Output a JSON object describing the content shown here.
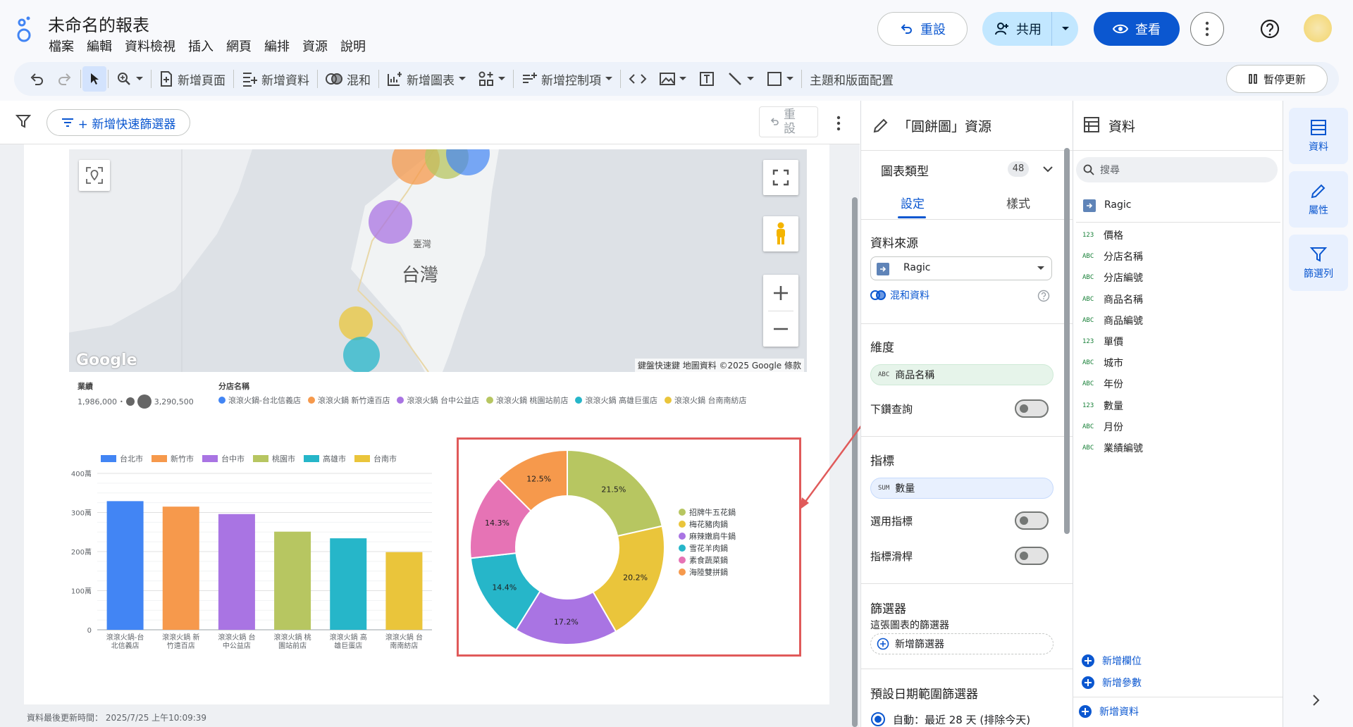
{
  "app": {
    "doc_title": "未命名的報表",
    "menu": [
      "檔案",
      "編輯",
      "資料檢視",
      "插入",
      "網頁",
      "編排",
      "資源",
      "說明"
    ],
    "reset_label": "重設",
    "share_label": "共用",
    "view_label": "查看"
  },
  "toolbar": {
    "add_page": "新增頁面",
    "add_data": "新增資料",
    "blend": "混和",
    "add_chart": "新增圖表",
    "add_control": "新增控制項",
    "theme": "主題和版面配置",
    "pause": "暫停更新"
  },
  "canvas": {
    "quick_filter": "+ 新增快速篩選器",
    "reset_label": "重設",
    "last_update": "資料最後更新時間：  2025/7/25 上午10:09:39"
  },
  "map": {
    "label_taiwan": "台灣",
    "label_taiwan_small": "臺灣",
    "google": "Google",
    "attribution": "鍵盤快速鍵    地圖資料 ©2025 Google    條款",
    "legend_metric_title": "業績",
    "legend_min": "1,986,000",
    "legend_max": "3,290,500",
    "legend_dim_title": "分店名稱",
    "stores": [
      {
        "name": "滾滾火鍋-台北信義店",
        "color": "#4285f4"
      },
      {
        "name": "滾滾火鍋 新竹遠百店",
        "color": "#f6994c"
      },
      {
        "name": "滾滾火鍋 台中公益店",
        "color": "#a974e3"
      },
      {
        "name": "滾滾火鍋 桃園站前店",
        "color": "#b7c661"
      },
      {
        "name": "滾滾火鍋 高雄巨蛋店",
        "color": "#26b6c9"
      },
      {
        "name": "滾滾火鍋 台南南紡店",
        "color": "#eac53b"
      }
    ]
  },
  "chart_data": [
    {
      "type": "bar",
      "title": "",
      "legend": [
        "台北市",
        "新竹市",
        "台中市",
        "桃園市",
        "高雄市",
        "台南市"
      ],
      "legend_position": "top",
      "categories": [
        "滾滾火鍋-台北信義店",
        "滾滾火鍋 新竹遠百店",
        "滾滾火鍋 台中公益店",
        "滾滾火鍋 桃園站前店",
        "滾滾火鍋 高雄巨蛋店",
        "滾滾火鍋 台南南紡店"
      ],
      "category_labels": [
        [
          "滾滾火鍋-台",
          "北信義店"
        ],
        [
          "滾滾火鍋 新",
          "竹遠百店"
        ],
        [
          "滾滾火鍋 台",
          "中公益店"
        ],
        [
          "滾滾火鍋 桃",
          "園站前店"
        ],
        [
          "滾滾火鍋 高",
          "雄巨蛋店"
        ],
        [
          "滾滾火鍋 台",
          "南南紡店"
        ]
      ],
      "values": [
        3290500,
        3150000,
        2960000,
        2510000,
        2340000,
        1986000
      ],
      "colors": [
        "#4285f4",
        "#f6994c",
        "#a974e3",
        "#b7c661",
        "#26b6c9",
        "#eac53b"
      ],
      "yticks": [
        "0",
        "100萬",
        "200萬",
        "300萬",
        "400萬"
      ],
      "ylim": [
        0,
        4000000
      ],
      "grid": true
    },
    {
      "type": "pie",
      "donut": true,
      "labels": [
        "招牌牛五花鍋",
        "梅花豬肉鍋",
        "麻辣嫩肩牛鍋",
        "雪花羊肉鍋",
        "素食蔬菜鍋",
        "海陸雙拼鍋"
      ],
      "values": [
        21.5,
        20.2,
        17.2,
        14.4,
        14.3,
        12.5
      ],
      "value_labels": [
        "21.5%",
        "20.2%",
        "17.2%",
        "14.4%",
        "14.3%",
        "12.5%"
      ],
      "colors": [
        "#b7c661",
        "#eac53b",
        "#a974e3",
        "#26b6c9",
        "#e673b5",
        "#f6994c"
      ],
      "legend_position": "right"
    }
  ],
  "props": {
    "title": "「圓餅圖」資源",
    "chart_type": "圖表類型",
    "chart_type_count": "48",
    "tab_setup": "設定",
    "tab_style": "樣式",
    "data_source_title": "資料來源",
    "data_source": "Ragic",
    "blend_data": "混和資料",
    "dimension_title": "維度",
    "dimension_tag": "ABC",
    "dimension_value": "商品名稱",
    "drill_down": "下鑽查詢",
    "metric_title": "指標",
    "metric_tag": "SUM",
    "metric_value": "數量",
    "optional_metrics": "選用指標",
    "metric_slider": "指標滑桿",
    "filter_title": "篩選器",
    "filter_desc": "這張圖表的篩選器",
    "add_filter": "新增篩選器",
    "date_range_title": "預設日期範圍篩選器",
    "date_auto": "自動：最近 28 天 (排除今天)"
  },
  "data_panel": {
    "title": "資料",
    "search_placeholder": "搜尋",
    "source": "Ragic",
    "fields": [
      {
        "type": "123",
        "name": "價格"
      },
      {
        "type": "ABC",
        "name": "分店名稱"
      },
      {
        "type": "ABC",
        "name": "分店編號"
      },
      {
        "type": "ABC",
        "name": "商品名稱"
      },
      {
        "type": "ABC",
        "name": "商品編號"
      },
      {
        "type": "123",
        "name": "單價"
      },
      {
        "type": "ABC",
        "name": "城市"
      },
      {
        "type": "ABC",
        "name": "年份"
      },
      {
        "type": "123",
        "name": "數量"
      },
      {
        "type": "ABC",
        "name": "月份"
      },
      {
        "type": "ABC",
        "name": "業績編號"
      }
    ],
    "add_field": "新增欄位",
    "add_param": "新增參數",
    "add_data": "新增資料"
  },
  "rail": {
    "data": "資料",
    "props": "屬性",
    "filter_bar": "篩選列"
  },
  "colors": {
    "accent": "#0b57d0",
    "highlight": "#e05a5a"
  }
}
